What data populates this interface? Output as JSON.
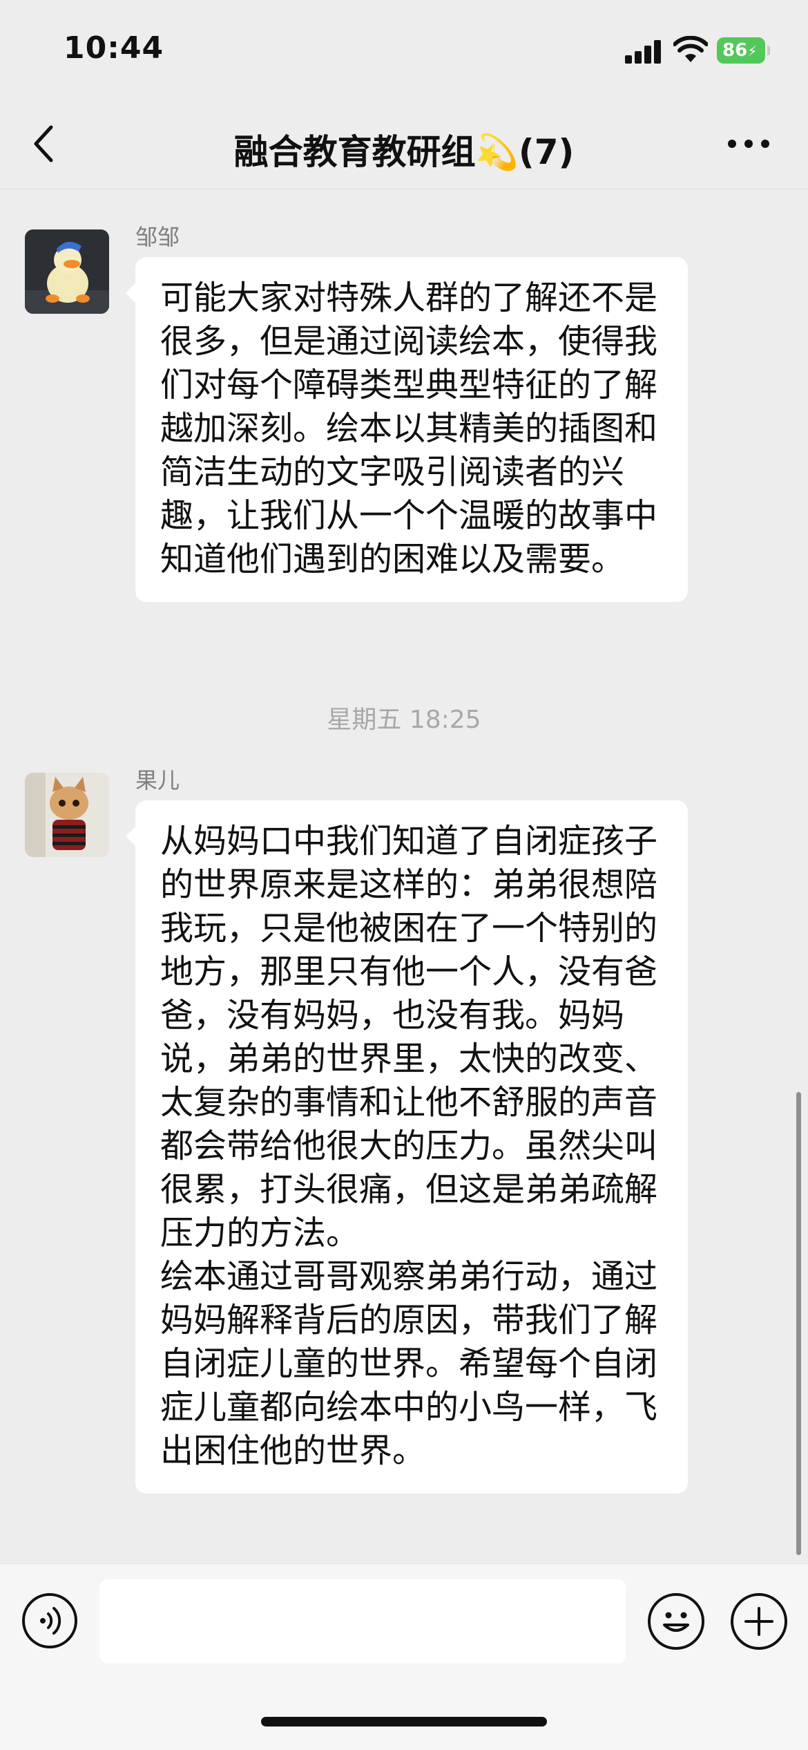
{
  "status_bar": {
    "time": "10:44",
    "battery": "86",
    "icons": [
      "signal-icon",
      "wifi-icon",
      "battery-icon"
    ]
  },
  "nav": {
    "title": "融合教育教研组💫(7)",
    "back_icon": "chevron-left-icon",
    "more_icon": "more-icon"
  },
  "messages": [
    {
      "sender": "邹邹",
      "avatar": "duck-avatar",
      "text": "可能大家对特殊人群的了解还不是很多，但是通过阅读绘本，使得我们对每个障碍类型典型特征的了解越加深刻。绘本以其精美的插图和简洁生动的文字吸引阅读者的兴趣，让我们从一个个温暖的故事中知道他们遇到的困难以及需要。"
    },
    {
      "sender": "果儿",
      "avatar": "cat-avatar",
      "text": "从妈妈口中我们知道了自闭症孩子的世界原来是这样的：弟弟很想陪我玩，只是他被困在了一个特别的地方，那里只有他一个人，没有爸爸，没有妈妈，也没有我。妈妈说，弟弟的世界里，太快的改变、太复杂的事情和让他不舒服的声音都会带给他很大的压力。虽然尖叫很累，打头很痛，但这是弟弟疏解压力的方法。\n绘本通过哥哥观察弟弟行动，通过妈妈解释背后的原因，带我们了解自闭症儿童的世界。希望每个自闭症儿童都向绘本中的小鸟一样，飞出困住他的世界。"
    }
  ],
  "timestamp": "星期五 18:25",
  "input_bar": {
    "placeholder": "",
    "icons": [
      "voice-icon",
      "emoji-icon",
      "plus-icon"
    ]
  },
  "colors": {
    "background": "#ededed",
    "bubble": "#ffffff",
    "battery": "#52c85a"
  }
}
